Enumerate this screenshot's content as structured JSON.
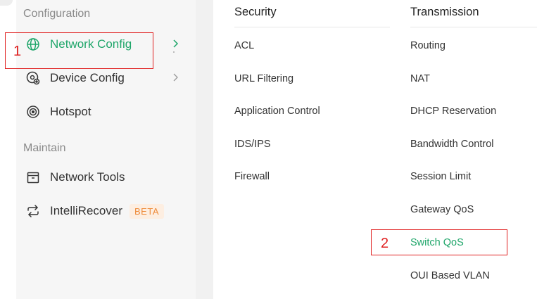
{
  "sidebar": {
    "sections": [
      {
        "title": "Configuration",
        "items": [
          {
            "label": "Network Config",
            "icon": "globe-icon",
            "active": true,
            "has_chevron": true
          },
          {
            "label": "Device Config",
            "icon": "device-settings-icon",
            "active": false,
            "has_chevron": true
          },
          {
            "label": "Hotspot",
            "icon": "hotspot-icon",
            "active": false,
            "has_chevron": false
          }
        ]
      },
      {
        "title": "Maintain",
        "items": [
          {
            "label": "Network Tools",
            "icon": "toolbox-icon",
            "active": false,
            "has_chevron": false
          },
          {
            "label": "IntelliRecover",
            "icon": "recover-arrows-icon",
            "badge": "BETA",
            "active": false,
            "has_chevron": false
          }
        ]
      }
    ]
  },
  "submenu": {
    "columns": [
      {
        "header": "Security",
        "links": [
          "ACL",
          "URL Filtering",
          "Application Control",
          "IDS/IPS",
          "Firewall"
        ]
      },
      {
        "header": "Transmission",
        "links": [
          "Routing",
          "NAT",
          "DHCP Reservation",
          "Bandwidth Control",
          "Session Limit",
          "Gateway QoS",
          "Switch QoS",
          "OUI Based VLAN"
        ],
        "active_link": "Switch QoS"
      }
    ]
  },
  "annotations": [
    {
      "number": "1",
      "target": "Network Config"
    },
    {
      "number": "2",
      "target": "Switch QoS"
    }
  ],
  "colors": {
    "accent": "#1fa66a",
    "annotation": "#e02020",
    "badge_text": "#ee8b3a",
    "badge_bg": "#fdeee1"
  }
}
